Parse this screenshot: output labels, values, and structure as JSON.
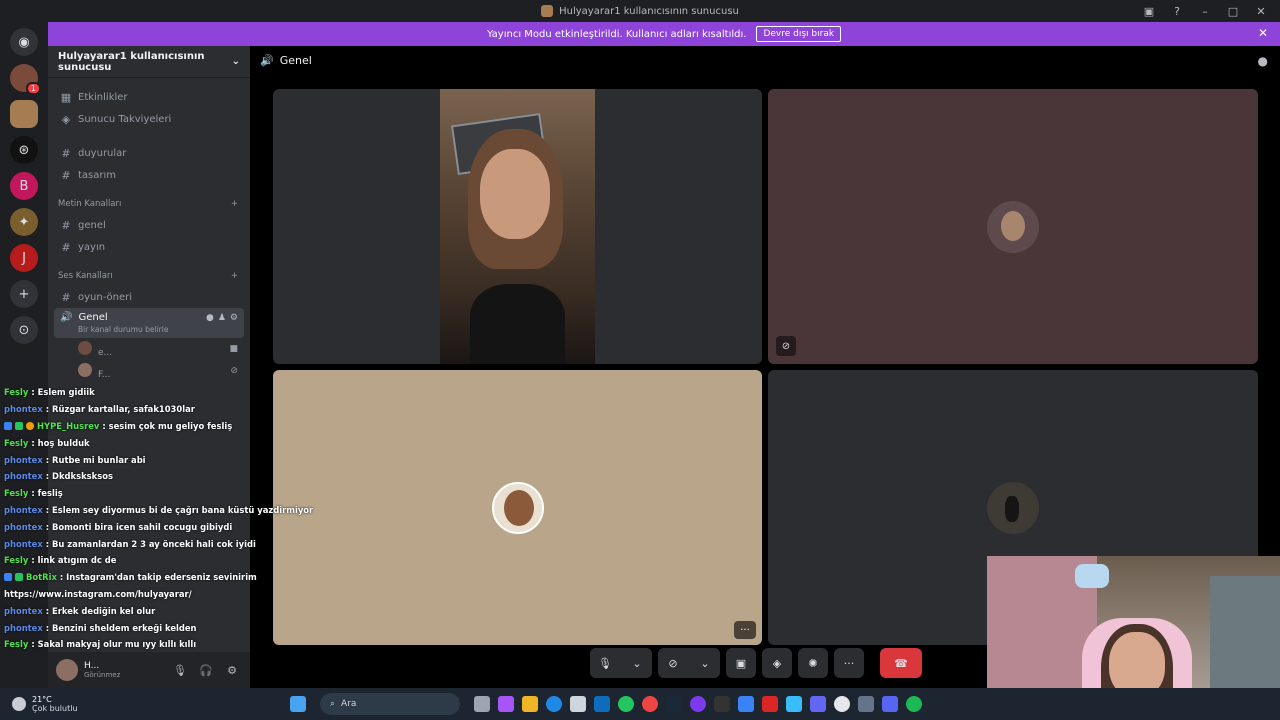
{
  "window": {
    "title": "Hulyayarar1 kullanıcısının sunucusu"
  },
  "banner": {
    "text": "Yayıncı Modu etkinleştirildi. Kullanıcı adları kısaltıldı.",
    "button": "Devre dışı bırak"
  },
  "server": {
    "name": "Hulyayarar1 kullanıcısının sunucusu",
    "top_items": [
      {
        "icon": "calendar-icon",
        "label": "Etkinlikler"
      },
      {
        "icon": "boost-icon",
        "label": "Sunucu Takviyeleri"
      }
    ],
    "uncat_channels": [
      {
        "label": "duyurular"
      },
      {
        "label": "tasarım"
      }
    ],
    "text_category": "Metin Kanalları",
    "text_channels": [
      {
        "label": "genel"
      },
      {
        "label": "yayın"
      }
    ],
    "voice_category": "Ses Kanalları",
    "voice_channels": [
      {
        "label": "oyun-öneri"
      }
    ],
    "active_voice": {
      "label": "Genel",
      "status_hint": "Bir kanal durumu belirle"
    },
    "members": [
      {
        "label": "e..."
      },
      {
        "label": "F..."
      }
    ]
  },
  "user": {
    "name": "H...",
    "status": "Görünmez"
  },
  "main": {
    "channel": "Genel"
  },
  "chat": [
    {
      "name": "Fesly",
      "color": "green",
      "badges": [],
      "text": ": Eslem gidiik"
    },
    {
      "name": "phontex",
      "color": "blue",
      "badges": [],
      "text": ": Rüzgar kartallar, safak1030lar"
    },
    {
      "name": "HYPE_Husrev",
      "color": "green",
      "badges": [
        "b",
        "g",
        "o"
      ],
      "text": ": sesim çok mu geliyo fesliş"
    },
    {
      "name": "Fesly",
      "color": "green",
      "badges": [],
      "text": ": hoş bulduk"
    },
    {
      "name": "phontex",
      "color": "blue",
      "badges": [],
      "text": ": Rutbe mi bunlar abi"
    },
    {
      "name": "phontex",
      "color": "blue",
      "badges": [],
      "text": ": Dkdksksksos"
    },
    {
      "name": "Fesly",
      "color": "green",
      "badges": [],
      "text": ": fesliş"
    },
    {
      "name": "phontex",
      "color": "blue",
      "badges": [],
      "text": ": Eslem sey diyormus bi de çağrı bana küstü yazdirmiyor"
    },
    {
      "name": "phontex",
      "color": "blue",
      "badges": [],
      "text": ": Bomonti bira icen sahil cocugu gibiydi"
    },
    {
      "name": "phontex",
      "color": "blue",
      "badges": [],
      "text": ": Bu zamanlardan 2 3 ay önceki hali cok iyidi"
    },
    {
      "name": "Fesly",
      "color": "green",
      "badges": [],
      "text": ": link atıgım dc de"
    },
    {
      "name": "BotRix",
      "color": "green",
      "badges": [
        "b",
        "g"
      ],
      "text": ": Instagram'dan takip ederseniz sevinirim"
    },
    {
      "name": "",
      "color": "blue",
      "badges": [],
      "text": "https://www.instagram.com/hulyayarar/"
    },
    {
      "name": "phontex",
      "color": "blue",
      "badges": [],
      "text": ": Erkek dediğin kel olur"
    },
    {
      "name": "phontex",
      "color": "blue",
      "badges": [],
      "text": ": Benzini sheldem erkeği kelden"
    },
    {
      "name": "Fesly",
      "color": "green",
      "badges": [],
      "text": ": Sakal makyaj olur mu ıyy kıllı kıllı"
    }
  ],
  "taskbar": {
    "temp": "21°C",
    "weather": "Çok bulutlu",
    "search_placeholder": "Ara"
  },
  "colors": {
    "accent": "#8e44d9",
    "leave": "#da373c",
    "chat_blue": "#5c8ae6",
    "chat_green": "#53e052"
  }
}
